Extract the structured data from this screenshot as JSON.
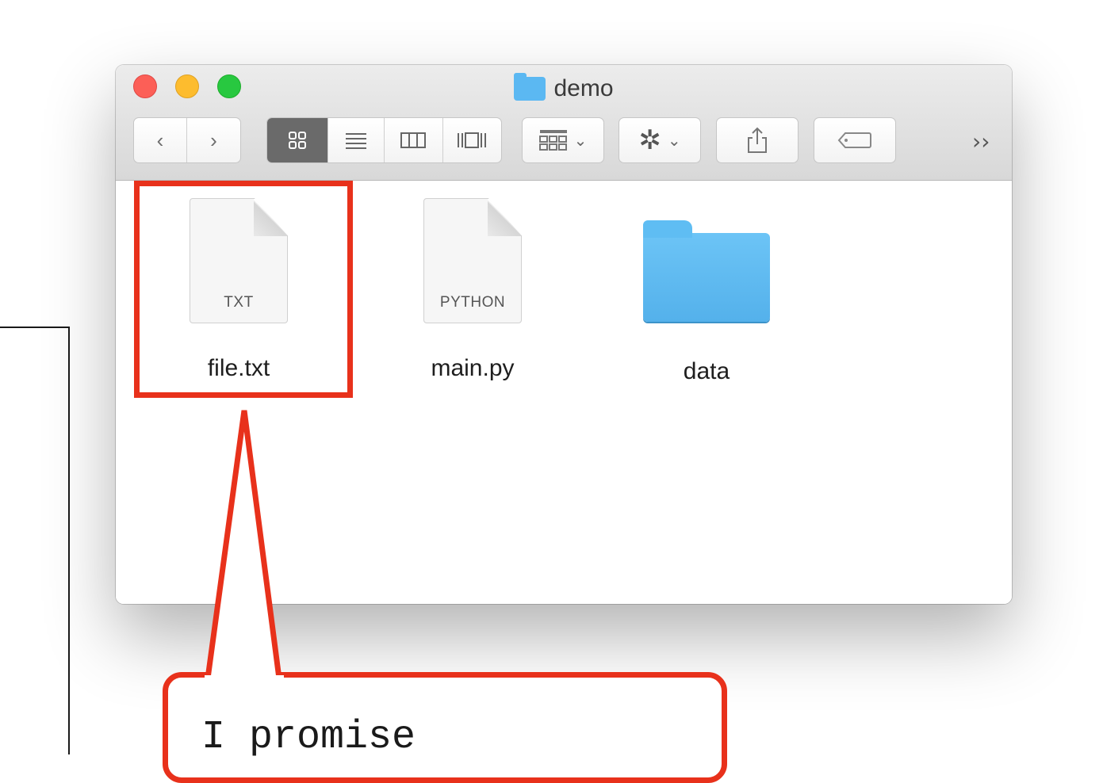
{
  "window": {
    "title": "demo",
    "toolbar": {
      "back_label": "‹",
      "forward_label": "›",
      "view_icon_glyph": "▫",
      "view_list_glyph": "≡",
      "view_column_glyph": "▥",
      "view_coverflow_glyph": "▯",
      "arrange_glyph": "▦",
      "action_glyph": "✲",
      "share_glyph": "⇧",
      "tag_glyph": "⬭",
      "more_label": "››"
    },
    "items": [
      {
        "name": "file.txt",
        "ext": "TXT",
        "icon": "text-file-icon"
      },
      {
        "name": "main.py",
        "ext": "PYTHON",
        "icon": "python-file-icon"
      },
      {
        "name": "data",
        "icon": "folder-icon"
      }
    ]
  },
  "annotation": {
    "callout_text": "I promise",
    "highlight_color": "#e8311b"
  }
}
